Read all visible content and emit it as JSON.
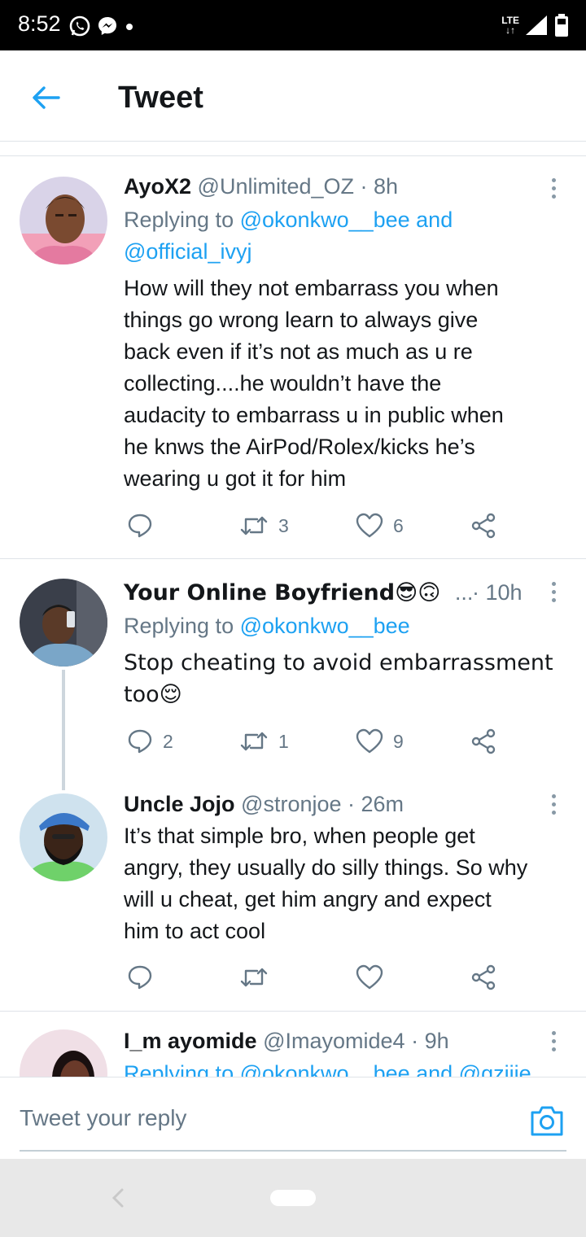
{
  "status_bar": {
    "time": "8:52",
    "network": "LTE"
  },
  "header": {
    "title": "Tweet"
  },
  "tweets": [
    {
      "name": "AyoX2",
      "handle": "@Unlimited_OZ",
      "time": "· 8h",
      "replying_prefix": "Replying to",
      "reply_line1_mention": "@okonkwo__bee and",
      "reply_line2_mention": "@official_ivyj",
      "text_lines": [
        "How will they not embarrass you when",
        "things go wrong learn to always give",
        "back even if it’s not as much as u re",
        "collecting....he wouldn’t have the",
        "audacity to embarrass u in public when",
        "he knws the AirPod/Rolex/kicks he’s",
        "wearing u got it for him"
      ],
      "replies": "",
      "retweets": "3",
      "likes": "6"
    },
    {
      "name": "Your Online Boyfriend😎🙃",
      "ellipsis": "...",
      "time": "· 10h",
      "replying_prefix": "Replying to",
      "reply_line1_mention": "@okonkwo__bee",
      "text_lines": [
        "Stop cheating to avoid embarrassment",
        "too😌"
      ],
      "replies": "2",
      "retweets": "1",
      "likes": "9"
    },
    {
      "name": "Uncle Jojo",
      "handle": "@stronjoe",
      "time": "· 26m",
      "text_lines": [
        "It’s that simple bro, when people get",
        "angry, they usually do silly things. So why",
        "will u cheat, get him angry and expect",
        "him to act cool"
      ],
      "replies": "",
      "retweets": "",
      "likes": ""
    },
    {
      "name": "I_m ayomide",
      "handle": "@Imayomide4",
      "time": "· 9h",
      "reply_partial": "Replying to @okonkwo__bee and @gziije"
    }
  ],
  "reply_bar": {
    "placeholder": "Tweet your reply"
  },
  "colors": {
    "accent": "#1da1f2",
    "secondary_text": "#657786",
    "divider": "#dfe3e8"
  },
  "icons": [
    "whatsapp-icon",
    "messenger-icon",
    "signal-icon",
    "battery-icon",
    "back-arrow-icon",
    "more-icon",
    "reply-icon",
    "retweet-icon",
    "like-icon",
    "share-icon",
    "camera-icon"
  ]
}
